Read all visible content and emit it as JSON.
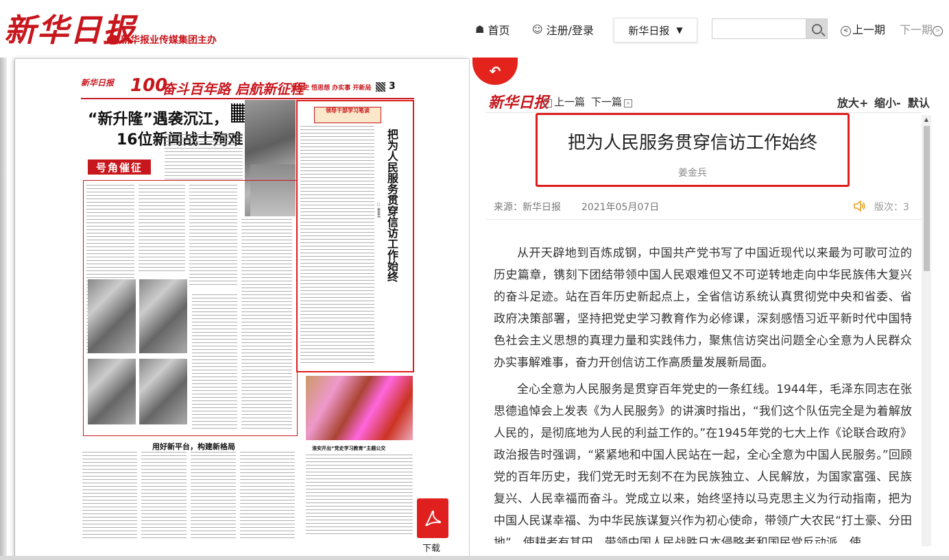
{
  "site": {
    "logo": "新华日报",
    "sublogo": "新华报业传媒集团主办"
  },
  "nav": {
    "home": "首页",
    "login": "注册/登录",
    "paper_select": "新华日报",
    "search_placeholder": "",
    "prev_issue": "上一期",
    "next_issue": "下一期"
  },
  "newspaper": {
    "logo": "新华日报",
    "page_number": "3",
    "banner": "奋斗百年路 启航新征程",
    "banner_sub": "学党史 悟思想 办实事 开新局",
    "headline_line1": "“新升隆”遇袭沉江，",
    "headline_line2": "16位新闻战士殉难",
    "horn_label": "号角催征",
    "column_badge": "领导干部学习笔谈",
    "highlight_title": "把为人民服务贯穿信访工作始终",
    "highlight_author": "□ 姜金兵",
    "section_title": "用好新平台，构建新格局",
    "photo_caption": "淮安开出“党史学习教育”主题公交"
  },
  "download": {
    "label": "下载"
  },
  "article": {
    "panel_logo": "新华日报",
    "prev": "上一篇",
    "next": "下一篇",
    "zoom_in": "放大+",
    "zoom_out": "缩小-",
    "zoom_reset": "默认",
    "title": "把为人民服务贯穿信访工作始终",
    "author": "姜金兵",
    "source": "来源：新华日报",
    "date": "2021年05月07日",
    "page": "版次：3",
    "paragraphs": [
      "从开天辟地到百炼成钢，中国共产党书写了中国近现代以来最为可歌可泣的历史篇章，镌刻下团结带领中国人民艰难但又不可逆转地走向中华民族伟大复兴的奋斗足迹。站在百年历史新起点上，全省信访系统认真贯彻党中央和省委、省政府决策部署，坚持把党史学习教育作为必修课，深刻感悟习近平新时代中国特色社会主义思想的真理力量和实践伟力，聚焦信访突出问题全心全意为人民群众办实事解难事，奋力开创信访工作高质量发展新局面。",
      "全心全意为人民服务是贯穿百年党史的一条红线。1944年，毛泽东同志在张思德追悼会上发表《为人民服务》的讲演时指出，“我们这个队伍完全是为着解放人民的，是彻底地为人民的利益工作的。”在1945年党的七大上作《论联合政府》政治报告时强调，“紧紧地和中国人民站在一起，全心全意为中国人民服务。”回顾党的百年历史，我们党无时无刻不在为民族独立、人民解放，为国家富强、民族复兴、人民幸福而奋斗。党成立以来，始终坚持以马克思主义为行动指南，把为中国人民谋幸福、为中华民族谋复兴作为初心使命，带领广大农民“打土豪、分田地”，使耕者有其田，带领中国人民战胜日本侵略者和国民党反动派，使"
    ]
  },
  "colors": {
    "brand_red": "#c8161d",
    "highlight_red": "#e01b1b"
  }
}
